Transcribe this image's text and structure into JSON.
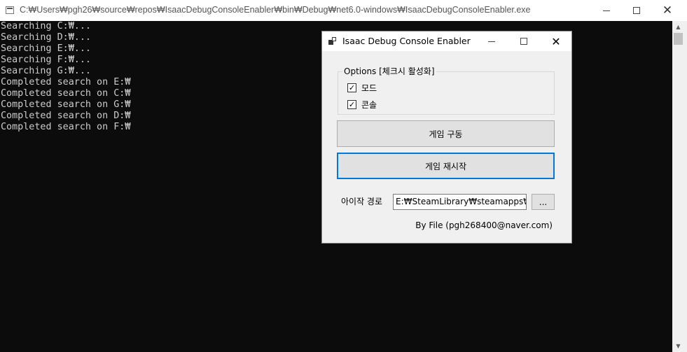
{
  "console_window": {
    "title": "C:₩Users₩pgh26₩source₩repos₩IsaacDebugConsoleEnabler₩bin₩Debug₩net6.0-windows₩IsaacDebugConsoleEnabler.exe",
    "lines": [
      "Searching C:₩...",
      "Searching D:₩...",
      "Searching E:₩...",
      "Searching F:₩...",
      "Searching G:₩...",
      "Completed search on E:₩",
      "Completed search on C:₩",
      "Completed search on G:₩",
      "Completed search on D:₩",
      "Completed search on F:₩"
    ],
    "text_color": "#cccccc",
    "background": "#0c0c0c"
  },
  "dialog": {
    "title": "Isaac Debug Console Enabler",
    "options_group": {
      "legend": "Options [체크시 활성화]",
      "items": [
        {
          "label": "모드",
          "checked": true
        },
        {
          "label": "콘솔",
          "checked": true
        }
      ]
    },
    "buttons": {
      "start_game": "게임 구동",
      "restart_game": "게임 재시작"
    },
    "path": {
      "label": "아이작 경로",
      "value": "E:₩SteamLibrary₩steamapps₩com",
      "browse_label": "..."
    },
    "credit": "By File (pgh268400@naver.com)",
    "accent": "#0078d7"
  }
}
